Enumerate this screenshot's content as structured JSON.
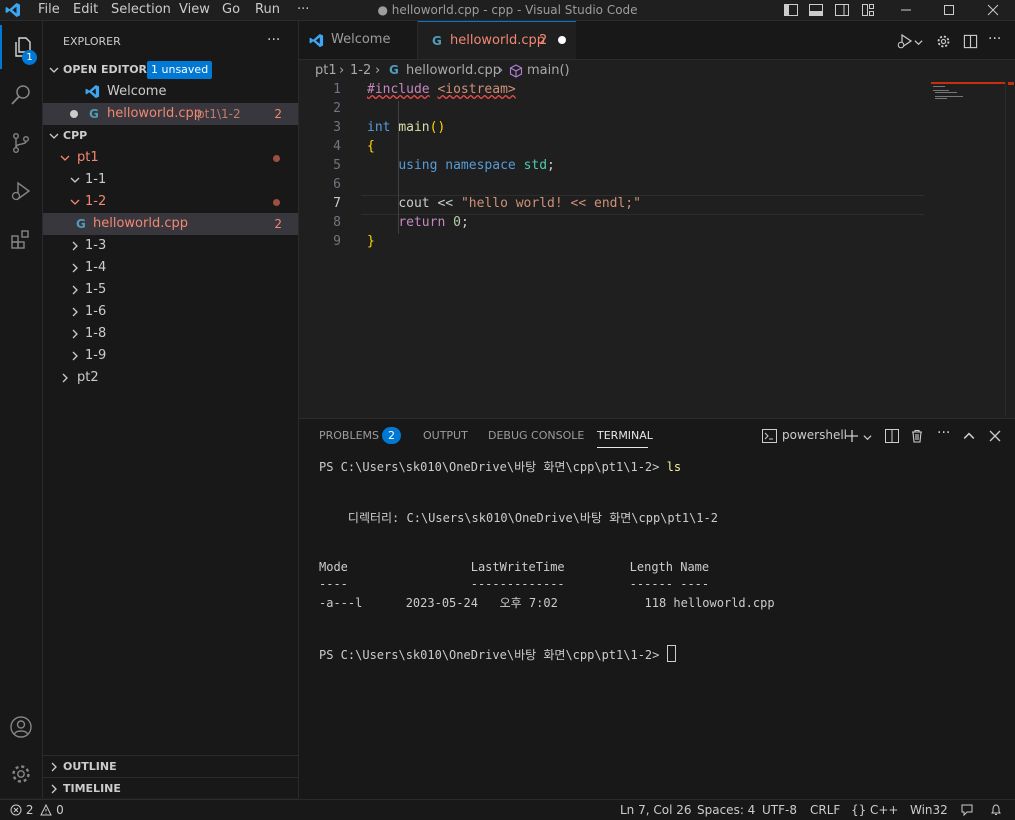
{
  "titlebar": {
    "menus": [
      "File",
      "Edit",
      "Selection",
      "View",
      "Go",
      "Run"
    ],
    "more": "···",
    "title": "● helloworld.cpp - cpp - Visual Studio Code"
  },
  "activity": {
    "explorer_badge": "1"
  },
  "sidebar": {
    "header": "EXPLORER",
    "more": "···",
    "open_editors_label": "OPEN EDITORS",
    "unsaved_badge": "1 unsaved",
    "open_editors": [
      {
        "name": "Welcome"
      },
      {
        "name": "helloworld.cpp",
        "path": "pt1\\1-2",
        "problems": "2"
      }
    ],
    "folder_label": "CPP",
    "tree": {
      "pt1": "pt1",
      "f11": "1-1",
      "f12": "1-2",
      "file": "helloworld.cpp",
      "file_problems": "2",
      "collapsed": [
        "1-3",
        "1-4",
        "1-5",
        "1-6",
        "1-8",
        "1-9"
      ],
      "pt2": "pt2"
    },
    "outline": "OUTLINE",
    "timeline": "TIMELINE"
  },
  "tabs": [
    {
      "label": "Welcome"
    },
    {
      "label": "helloworld.cpp",
      "problems": "2"
    }
  ],
  "breadcrumb": {
    "a": "pt1",
    "b": "1-2",
    "c": "helloworld.cpp",
    "d": "main()"
  },
  "code": {
    "line_numbers": [
      "1",
      "2",
      "3",
      "4",
      "5",
      "6",
      "7",
      "8",
      "9"
    ],
    "l1_pp": "#include",
    "l1_hdr": "<iostream>",
    "l3_kw": "int",
    "l3_fn": "main",
    "l3_paren": "()",
    "l4": "{",
    "l5_a": "using",
    "l5_b": "namespace",
    "l5_c": "std",
    "l5_d": ";",
    "l7_a": "cout",
    "l7_b": " << ",
    "l7_c": "\"hello world! << endl;\"",
    "l8_a": "return",
    "l8_b": "0",
    "l8_c": ";",
    "l9": "}"
  },
  "panel": {
    "tabs": [
      "PROBLEMS",
      "OUTPUT",
      "DEBUG CONSOLE",
      "TERMINAL"
    ],
    "problems_count": "2",
    "shell": "powershell",
    "terminal_lines": [
      "PS C:\\Users\\sk010\\OneDrive\\바탕 화면\\cpp\\pt1\\1-2> ",
      "    디렉터리: C:\\Users\\sk010\\OneDrive\\바탕 화면\\cpp\\pt1\\1-2",
      "Mode                 LastWriteTime         Length Name",
      "----                 -------------         ------ ----",
      "-a---l      2023-05-24   오후 7:02            118 helloworld.cpp",
      "PS C:\\Users\\sk010\\OneDrive\\바탕 화면\\cpp\\pt1\\1-2> "
    ],
    "command": "ls"
  },
  "status": {
    "errors": "2",
    "warnings": "0",
    "position": "Ln 7, Col 26",
    "spaces": "Spaces: 4",
    "encoding": "UTF-8",
    "eol": "CRLF",
    "lang": "C++",
    "lang_braces": "{}",
    "platform": "Win32"
  }
}
